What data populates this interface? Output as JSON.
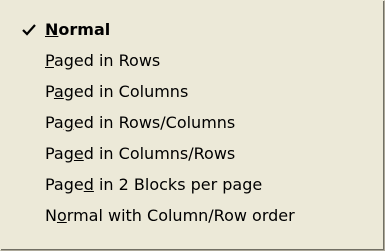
{
  "menu": {
    "items": [
      {
        "pre": "",
        "mnemonic": "N",
        "post": "ormal",
        "checked": true
      },
      {
        "pre": "",
        "mnemonic": "P",
        "post": "aged in Rows",
        "checked": false
      },
      {
        "pre": "P",
        "mnemonic": "a",
        "post": "ged in Columns",
        "checked": false
      },
      {
        "pre": "Pa",
        "mnemonic": "g",
        "post": "ed in Rows/Columns",
        "checked": false
      },
      {
        "pre": "Pag",
        "mnemonic": "e",
        "post": "d in Columns/Rows",
        "checked": false
      },
      {
        "pre": "Page",
        "mnemonic": "d",
        "post": " in 2 Blocks per page",
        "checked": false
      },
      {
        "pre": "N",
        "mnemonic": "o",
        "post": "rmal with Column/Row order",
        "checked": false
      }
    ],
    "check_icon": "checkmark-icon"
  }
}
